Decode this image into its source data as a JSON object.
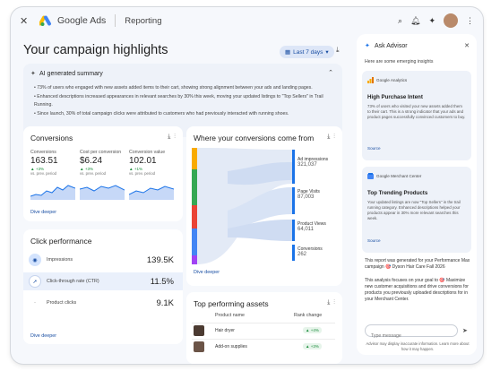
{
  "topbar": {
    "brand": "Google Ads",
    "crumb": "Reporting"
  },
  "page": {
    "title": "Your campaign highlights",
    "date_range": "Last 7 days"
  },
  "ai_summary": {
    "title": "AI generated summary",
    "bullets": [
      "• 73% of users who engaged with new assets added items to their cart, showing strong alignment between your ads and landing pages.",
      "• Enhanced descriptions increased appearances in relevant searches by 30% this week, moving your updated listings to \"Top Sellers\" in Trail Running.",
      "• Since launch, 30% of total campaign clicks were attributed to customers who had previously interacted with running shoes."
    ]
  },
  "conversions": {
    "title": "Conversions",
    "metrics": [
      {
        "label": "Conversions",
        "value": "163.51",
        "delta": "▲ +3%",
        "sub": "vs. prev. period"
      },
      {
        "label": "Cost per conversion",
        "value": "$6.24",
        "delta": "▲ +3%",
        "sub": "vs. prev. period"
      },
      {
        "label": "Conversion value",
        "value": "102.01",
        "delta": "▲ +1%",
        "sub": "vs. prev. period"
      }
    ],
    "link": "Dive deeper"
  },
  "click_performance": {
    "title": "Click performance",
    "rows": [
      {
        "label": "Impressions",
        "value": "139.5K"
      },
      {
        "label": "Click-through rate (CTR)",
        "value": "11.5%"
      },
      {
        "label": "Product clicks",
        "value": "9.1K"
      }
    ],
    "link": "Dive deeper"
  },
  "where": {
    "title": "Where your conversions come from",
    "nodes": [
      {
        "label": "Ad impressions",
        "value": "321,037"
      },
      {
        "label": "Page Visits",
        "value": "87,003"
      },
      {
        "label": "Product Views",
        "value": "64,011"
      },
      {
        "label": "Conversions",
        "value": "262"
      }
    ],
    "link": "Dive deeper",
    "colors": [
      "#f9ab00",
      "#34a853",
      "#ea4335",
      "#4285f4",
      "#a142f4"
    ]
  },
  "top_assets": {
    "title": "Top performing assets",
    "col_name": "Product name",
    "col_rank": "Rank change",
    "rows": [
      {
        "name": "Hair dryer",
        "rank": "▲ +4%"
      },
      {
        "name": "Add-on supplies",
        "rank": "▲ +3%"
      }
    ]
  },
  "advisor": {
    "title": "Ask Advisor",
    "intro": "Here are some emerging insights",
    "cards": [
      {
        "source": "Google Analytics",
        "headline": "High Purchase Intent",
        "body": "73% of users who visited your new assets added them to their cart. This is a strong indicator that your ads and product pages successfully convinced customers to buy.",
        "link": "Source"
      },
      {
        "source": "Google Merchant Center",
        "headline": "Top Trending Products",
        "body": "Your updated listings are now \"Top Sellers\" in the trail running category. Enhanced descriptions helped your products appear in 30% more relevant searches this week.",
        "link": "Source"
      }
    ],
    "report_line": "This report was generated for your Performance Max campaign 🎯 Dyson Hair Care Fall 2026",
    "goal_text": "This analysis focuses on your goal to 🎯 Maximize new customer acquisitions and drive conversions for products you previously uploaded descriptions for in your Merchant Center.",
    "input_placeholder": "Type message",
    "note": "Advisor may display inaccurate information. Learn more about how it may happen."
  }
}
